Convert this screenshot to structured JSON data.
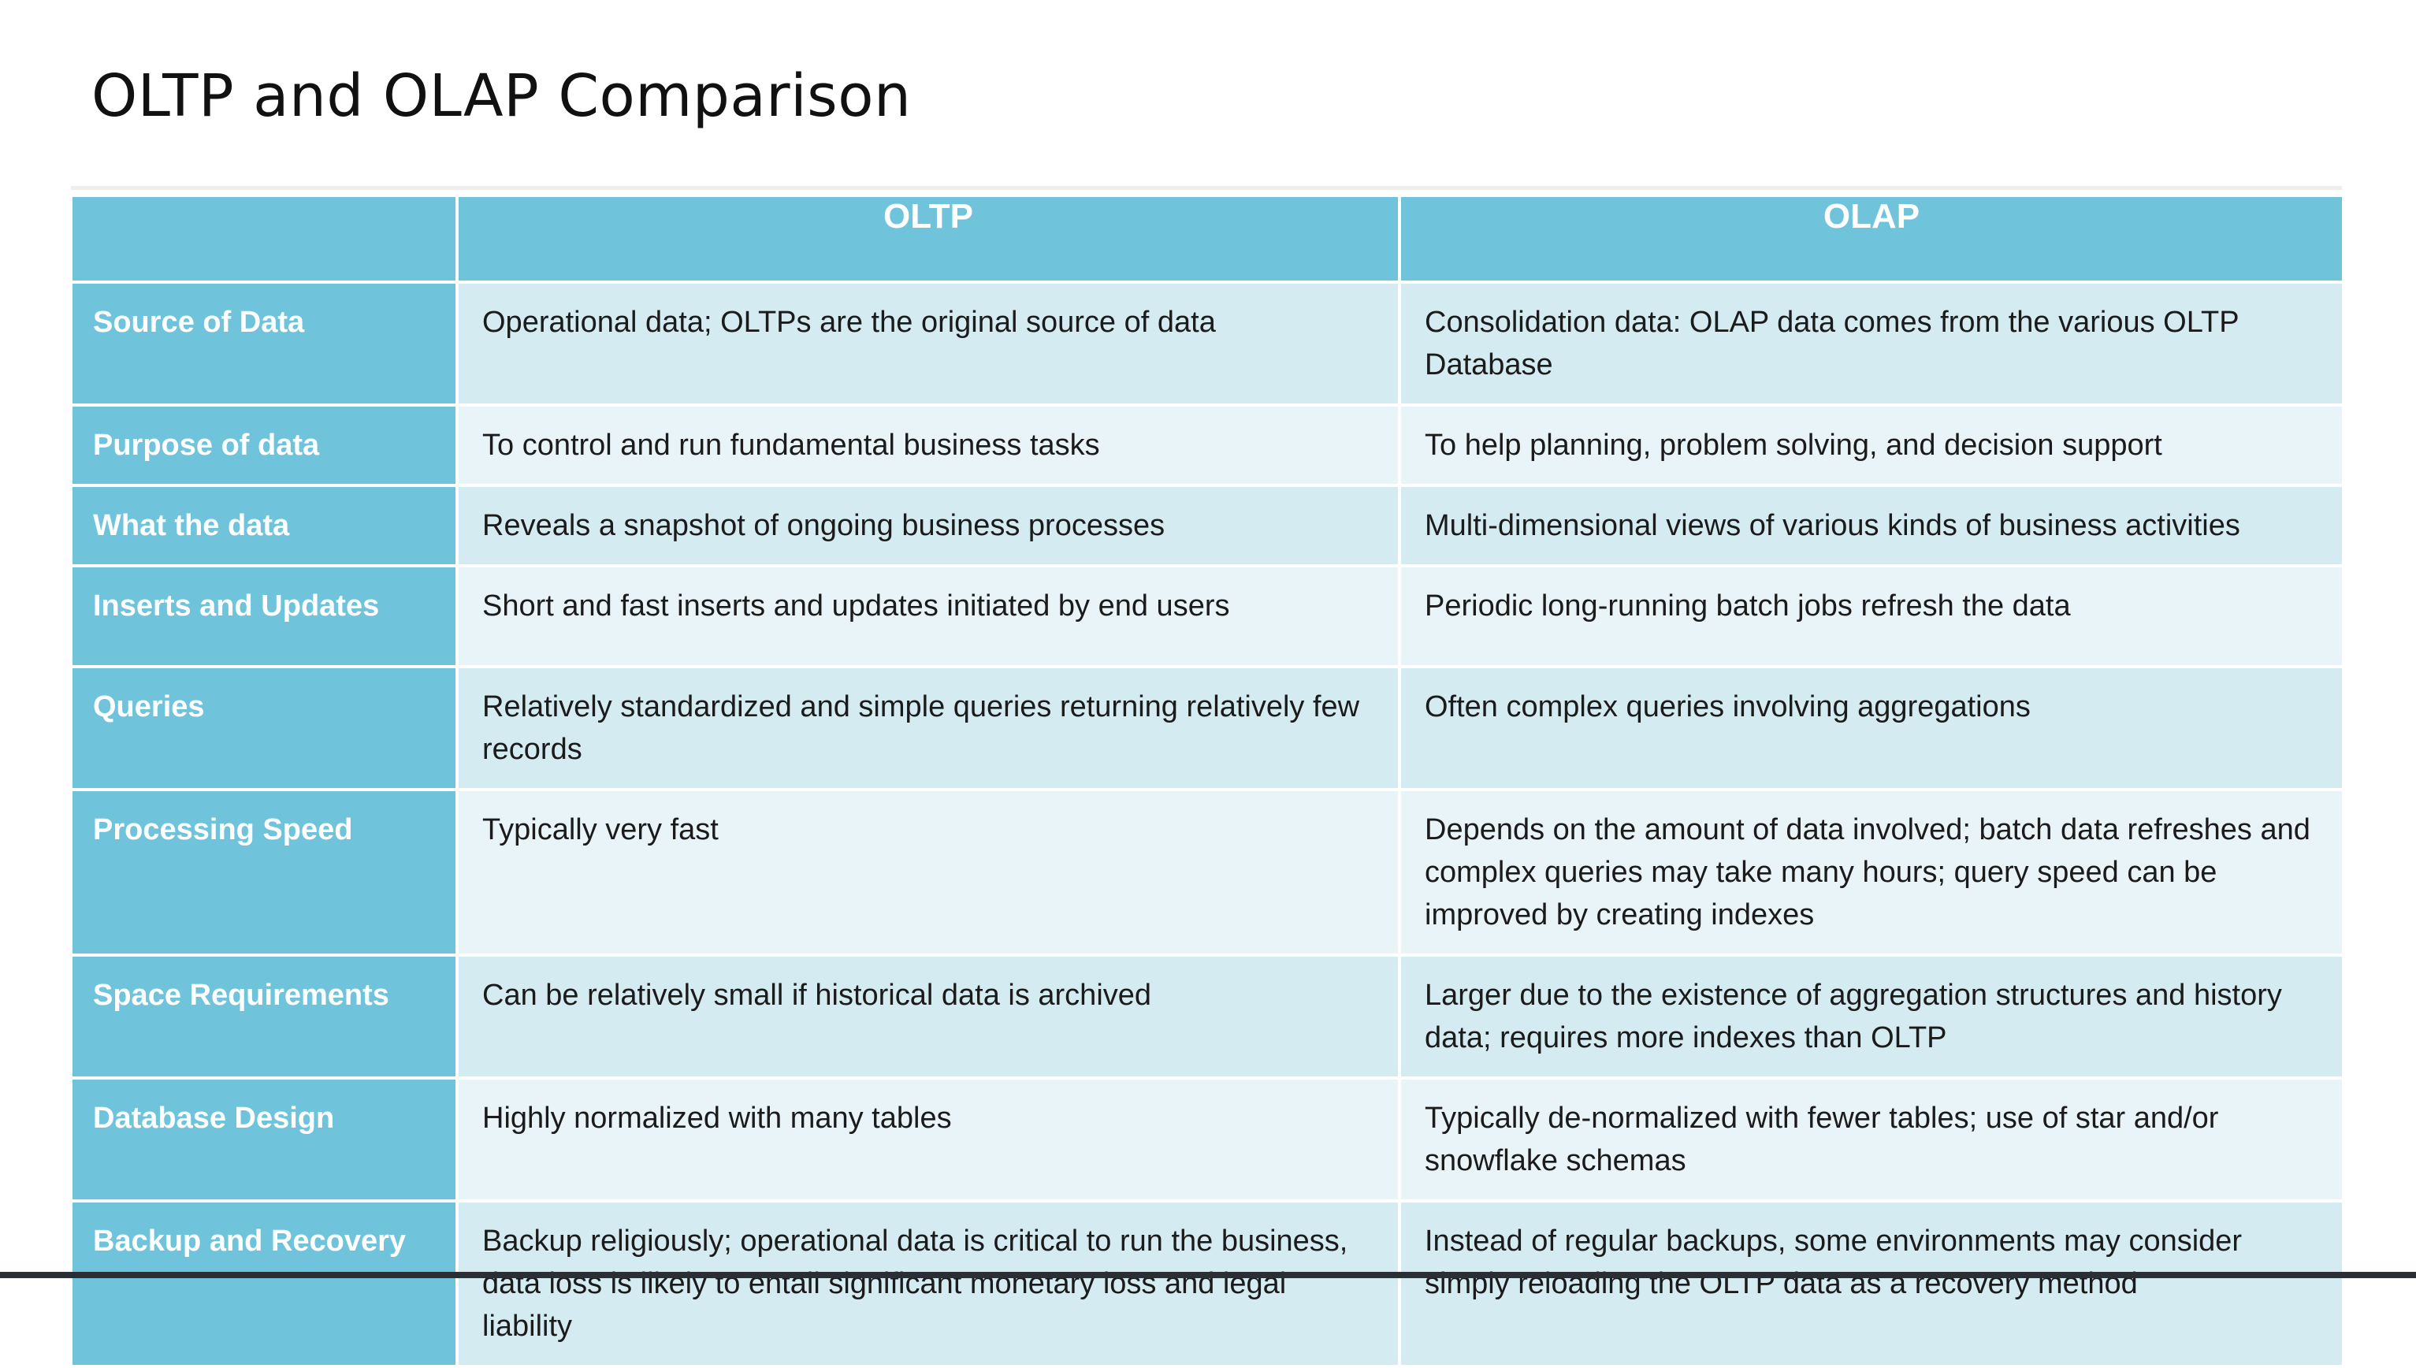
{
  "title": "OLTP and OLAP Comparison",
  "table": {
    "headers": {
      "corner": "",
      "oltp": "OLTP",
      "olap": "OLAP"
    },
    "rows": [
      {
        "label": "Source of Data",
        "oltp": "Operational data; OLTPs are the original source of data",
        "olap": "Consolidation data: OLAP data comes from the various OLTP Database"
      },
      {
        "label": "Purpose of data",
        "oltp": "To control and run fundamental business tasks",
        "olap": "To help planning, problem solving, and decision support"
      },
      {
        "label": "What the data",
        "oltp": "Reveals a snapshot of ongoing business processes",
        "olap": "Multi-dimensional views of various kinds of business activities"
      },
      {
        "label": "Inserts and Updates",
        "oltp": "Short and fast inserts and updates initiated by end users",
        "olap": "Periodic long-running batch jobs refresh the data"
      },
      {
        "label": "Queries",
        "oltp": "Relatively standardized and simple queries returning relatively few records",
        "olap": "Often complex queries involving aggregations"
      },
      {
        "label": "Processing Speed",
        "oltp": "Typically very fast",
        "olap": "Depends on the amount of data involved; batch data refreshes and complex queries may take many hours; query speed can be improved by  creating indexes"
      },
      {
        "label": "Space Requirements",
        "oltp": "Can be relatively small if historical data is archived",
        "olap": "Larger due to the existence of aggregation structures and history data; requires more indexes than OLTP"
      },
      {
        "label": "Database Design",
        "oltp": "Highly normalized with many tables",
        "olap": "Typically de-normalized with fewer tables; use of star and/or snowflake schemas"
      },
      {
        "label": "Backup and Recovery",
        "oltp": "Backup religiously; operational data is critical to run the business, data loss is likely to entail significant monetary loss and legal liability",
        "olap": "Instead of regular backups, some environments may consider simply reloading the OLTP data as a recovery method"
      }
    ]
  },
  "colors": {
    "header_bg": "#6fc4db",
    "row_odd_bg": "#d5ebf2",
    "row_even_bg": "#e9f4f8",
    "header_text": "#ffffff"
  }
}
